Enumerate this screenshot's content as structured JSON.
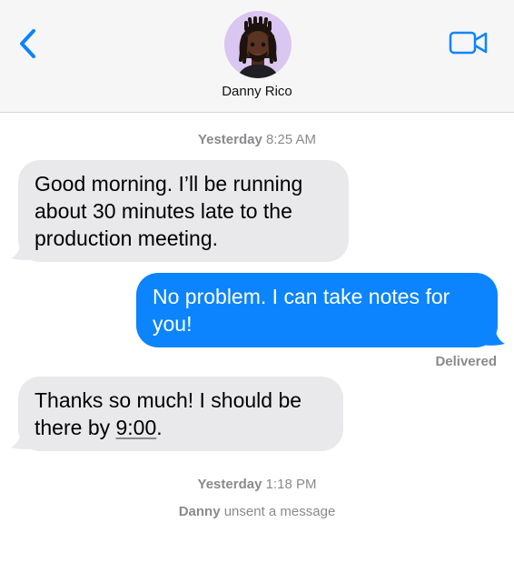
{
  "header": {
    "contact_name": "Danny Rico",
    "back_icon": "chevron-left-icon",
    "video_icon": "video-camera-icon",
    "accent_color": "#0b84fe"
  },
  "messages": {
    "timestamp_1": {
      "day": "Yesterday",
      "time": "8:25 AM"
    },
    "incoming_1": "Good morning. I’ll be running about 30 minutes late to the production meeting.",
    "outgoing_1": "No problem. I can take notes for you!",
    "delivery_status": "Delivered",
    "incoming_2_prefix": "Thanks so much! I should be there by ",
    "incoming_2_time": "9:00",
    "incoming_2_suffix": ".",
    "timestamp_2": {
      "day": "Yesterday",
      "time": "1:18 PM"
    },
    "unsent_notice": {
      "name": "Danny",
      "text": "unsent a message"
    }
  },
  "colors": {
    "incoming_bubble": "#e9e9eb",
    "outgoing_bubble": "#0b84fe",
    "meta_text": "#8a8a8e"
  }
}
